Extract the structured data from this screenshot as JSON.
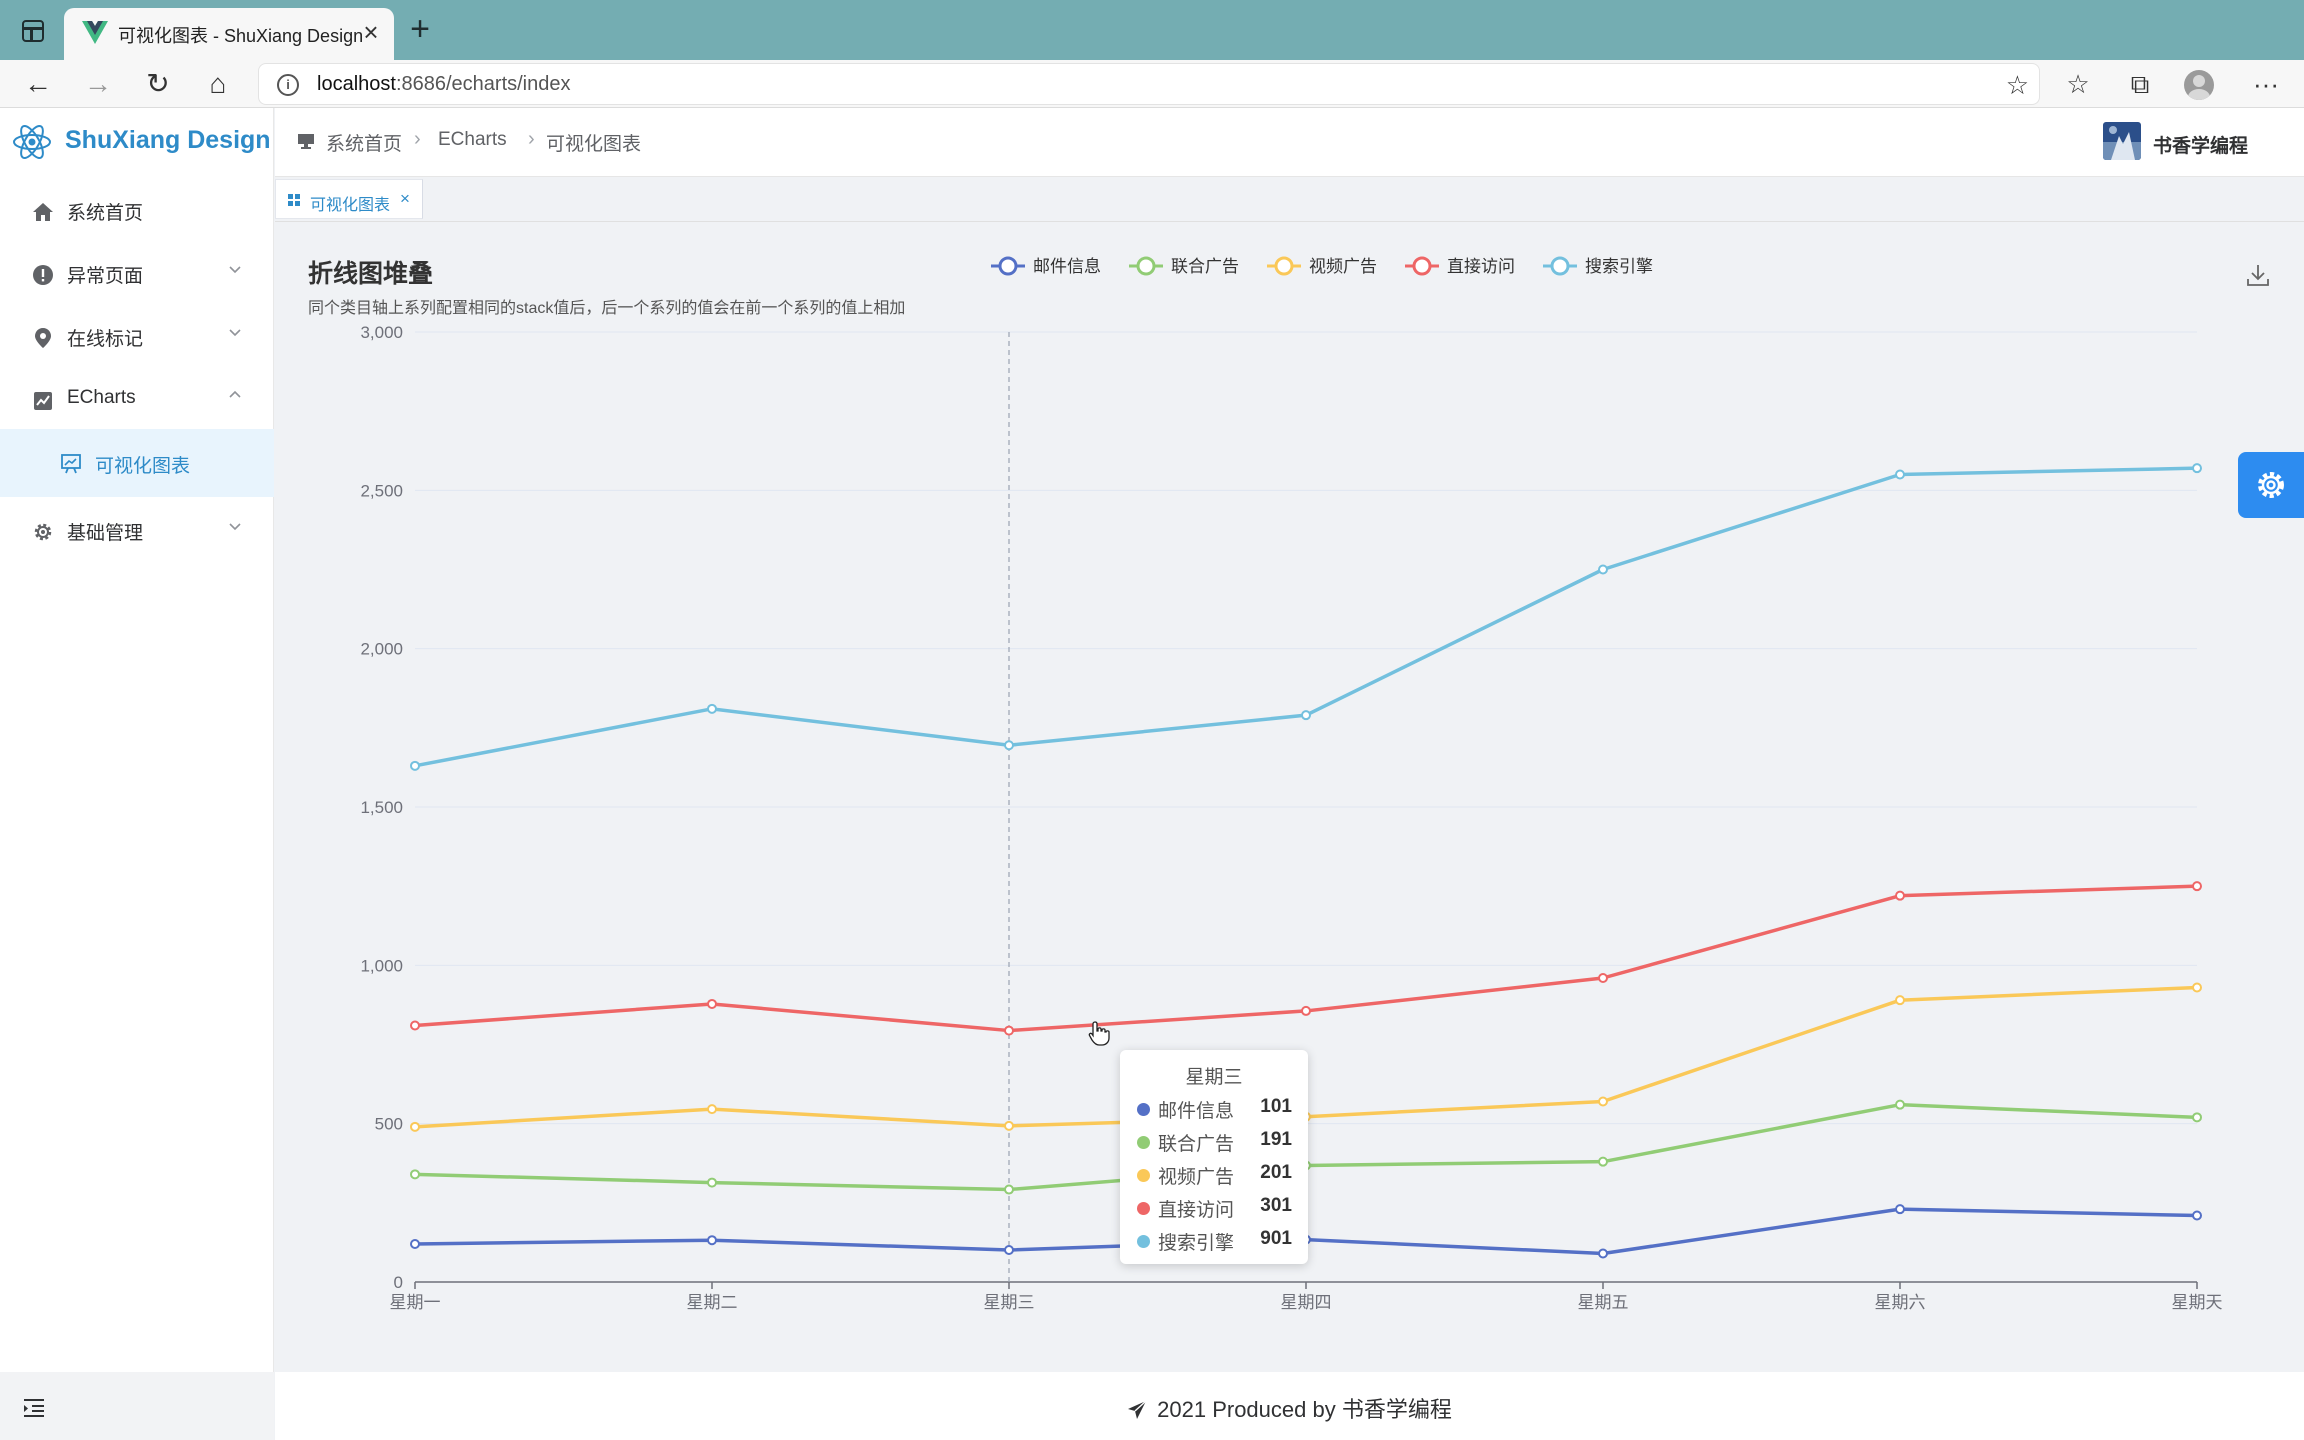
{
  "browser": {
    "tab_title": "可视化图表 - ShuXiang Design",
    "url_host": "localhost",
    "url_rest": ":8686/echarts/index"
  },
  "sidebar": {
    "logo_text": "ShuXiang Design",
    "items": [
      {
        "label": "系统首页"
      },
      {
        "label": "异常页面"
      },
      {
        "label": "在线标记"
      },
      {
        "label": "ECharts"
      },
      {
        "label": "可视化图表"
      },
      {
        "label": "基础管理"
      }
    ]
  },
  "header": {
    "breadcrumb": [
      "系统首页",
      "ECharts",
      "可视化图表"
    ],
    "user_name": "书香学编程"
  },
  "tags": [
    {
      "label": "可视化图表"
    }
  ],
  "chart_data": {
    "type": "line",
    "title": "折线图堆叠",
    "subtitle": "同个类目轴上系列配置相同的stack值后，后一个系列的值会在前一个系列的值上相加",
    "categories": [
      "星期一",
      "星期二",
      "星期三",
      "星期四",
      "星期五",
      "星期六",
      "星期天"
    ],
    "ylim": [
      0,
      3000
    ],
    "yticks": [
      0,
      500,
      1000,
      1500,
      2000,
      2500,
      3000
    ],
    "ytick_labels": [
      "0",
      "500",
      "1,000",
      "1,500",
      "2,000",
      "2,500",
      "3,000"
    ],
    "legend_position": "top-center",
    "grid": true,
    "stacked": true,
    "series": [
      {
        "name": "邮件信息",
        "color": "#5470c6",
        "values": [
          120,
          132,
          101,
          134,
          90,
          230,
          210
        ]
      },
      {
        "name": "联合广告",
        "color": "#91cc75",
        "values": [
          220,
          182,
          191,
          234,
          290,
          330,
          310
        ]
      },
      {
        "name": "视频广告",
        "color": "#fac858",
        "values": [
          150,
          232,
          201,
          154,
          190,
          330,
          410
        ]
      },
      {
        "name": "直接访问",
        "color": "#ee6666",
        "values": [
          320,
          332,
          301,
          334,
          390,
          330,
          320
        ]
      },
      {
        "name": "搜索引擎",
        "color": "#73c0de",
        "values": [
          820,
          932,
          901,
          934,
          1290,
          1330,
          1320
        ]
      }
    ],
    "tooltip": {
      "category": "星期三",
      "rows": [
        {
          "name": "邮件信息",
          "value": "101",
          "color": "#5470c6"
        },
        {
          "name": "联合广告",
          "value": "191",
          "color": "#91cc75"
        },
        {
          "name": "视频广告",
          "value": "201",
          "color": "#fac858"
        },
        {
          "name": "直接访问",
          "value": "301",
          "color": "#ee6666"
        },
        {
          "name": "搜索引擎",
          "value": "901",
          "color": "#73c0de"
        }
      ]
    }
  },
  "footer": {
    "text": "2021 Produced by 书香学编程"
  },
  "colors": {
    "accent": "#2e8bc8",
    "settings_button": "#2d8cf0",
    "browser_frame": "#74adb2"
  }
}
